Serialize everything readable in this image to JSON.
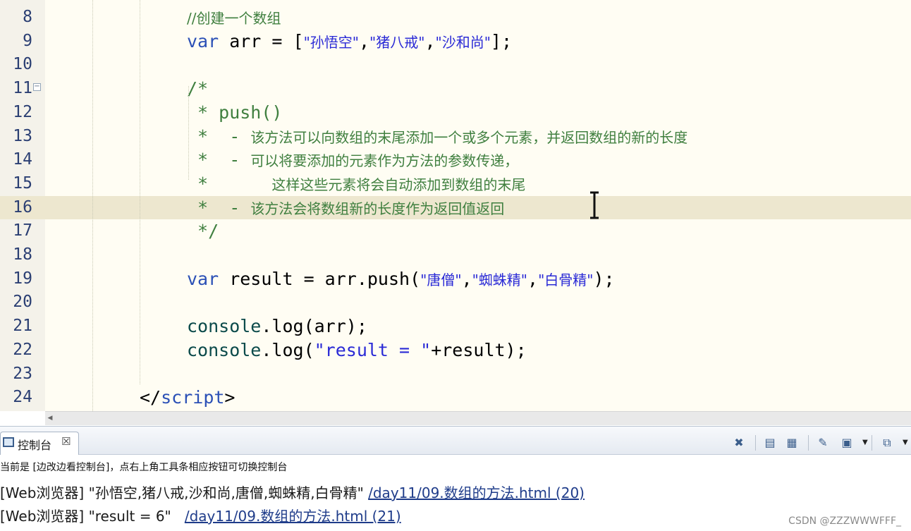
{
  "editor": {
    "current_line": 16,
    "lines": [
      {
        "num": "8",
        "tokens": [
          {
            "t": "//创建一个数组",
            "c": "cmt zh"
          }
        ]
      },
      {
        "num": "9",
        "tokens": [
          {
            "t": "var",
            "c": "kw"
          },
          {
            "t": " arr = [",
            "c": ""
          },
          {
            "t": "\"孙悟空\"",
            "c": "str zh"
          },
          {
            "t": ",",
            "c": ""
          },
          {
            "t": "\"猪八戒\"",
            "c": "str zh"
          },
          {
            "t": ",",
            "c": ""
          },
          {
            "t": "\"沙和尚\"",
            "c": "str zh"
          },
          {
            "t": "];",
            "c": ""
          }
        ]
      },
      {
        "num": "10",
        "tokens": []
      },
      {
        "num": "11",
        "fold": "−",
        "tokens": [
          {
            "t": "/*",
            "c": "cmt"
          }
        ]
      },
      {
        "num": "12",
        "tokens": [
          {
            "t": " * push()",
            "c": "cmt"
          }
        ]
      },
      {
        "num": "13",
        "tokens": [
          {
            "t": " *  - ",
            "c": "cmt"
          },
          {
            "t": "该方法可以向数组的末尾添加一个或多个元素，并返回数组的新的长度",
            "c": "cmt zh"
          }
        ]
      },
      {
        "num": "14",
        "tokens": [
          {
            "t": " *  - ",
            "c": "cmt"
          },
          {
            "t": "可以将要添加的元素作为方法的参数传递，",
            "c": "cmt zh"
          }
        ]
      },
      {
        "num": "15",
        "tokens": [
          {
            "t": " *      ",
            "c": "cmt"
          },
          {
            "t": "这样这些元素将会自动添加到数组的末尾",
            "c": "cmt zh"
          }
        ]
      },
      {
        "num": "16",
        "tokens": [
          {
            "t": " *  - ",
            "c": "cmt"
          },
          {
            "t": "该方法会将数组新的长度作为返回值返回",
            "c": "cmt zh"
          }
        ]
      },
      {
        "num": "17",
        "tokens": [
          {
            "t": " */",
            "c": "cmt"
          }
        ]
      },
      {
        "num": "18",
        "tokens": []
      },
      {
        "num": "19",
        "tokens": [
          {
            "t": "var",
            "c": "kw"
          },
          {
            "t": " result = arr.push(",
            "c": ""
          },
          {
            "t": "\"唐僧\"",
            "c": "str zh"
          },
          {
            "t": ",",
            "c": ""
          },
          {
            "t": "\"蜘蛛精\"",
            "c": "str zh"
          },
          {
            "t": ",",
            "c": ""
          },
          {
            "t": "\"白骨精\"",
            "c": "str zh"
          },
          {
            "t": ");",
            "c": ""
          }
        ]
      },
      {
        "num": "20",
        "tokens": []
      },
      {
        "num": "21",
        "tokens": [
          {
            "t": "console",
            "c": "fn"
          },
          {
            "t": ".log(arr);",
            "c": ""
          }
        ]
      },
      {
        "num": "22",
        "tokens": [
          {
            "t": "console",
            "c": "fn"
          },
          {
            "t": ".log(",
            "c": ""
          },
          {
            "t": "\"result = \"",
            "c": "str"
          },
          {
            "t": "+result);",
            "c": ""
          }
        ]
      },
      {
        "num": "23",
        "tokens": []
      },
      {
        "num": "24",
        "indent": "script",
        "tokens": [
          {
            "t": "</",
            "c": ""
          },
          {
            "t": "script",
            "c": "kw"
          },
          {
            "t": ">",
            "c": ""
          }
        ]
      }
    ]
  },
  "console": {
    "tab_label": "控制台",
    "tab_close": "☒",
    "status": "当前是 [边改边看控制台]，点右上角工具条相应按钮可切换控制台",
    "output": [
      {
        "prefix": "[Web浏览器] ",
        "message": "\"孙悟空,猪八戒,沙和尚,唐僧,蜘蛛精,白骨精\"",
        "link": "/day11/09.数组的方法.html (20)"
      },
      {
        "prefix": "[Web浏览器] ",
        "message": "\"result = 6\"  ",
        "link": "/day11/09.数组的方法.html (21)"
      }
    ],
    "toolbar": [
      {
        "name": "clear-console-icon",
        "glyph": "✖"
      },
      {
        "name": "remove-launch-icon",
        "glyph": "▤"
      },
      {
        "name": "scroll-lock-icon",
        "glyph": "▦"
      },
      {
        "name": "pin-console-icon",
        "glyph": "✎"
      },
      {
        "name": "display-console-icon",
        "glyph": "▣"
      },
      {
        "name": "open-console-icon",
        "glyph": "⧉"
      }
    ]
  },
  "watermark": "CSDN @ZZZWWWFFF_",
  "colors": {
    "keyword": "#2b50b6",
    "string": "#2a2ad6",
    "comment": "#3f7f3f",
    "current_line": "#ede7cf"
  }
}
